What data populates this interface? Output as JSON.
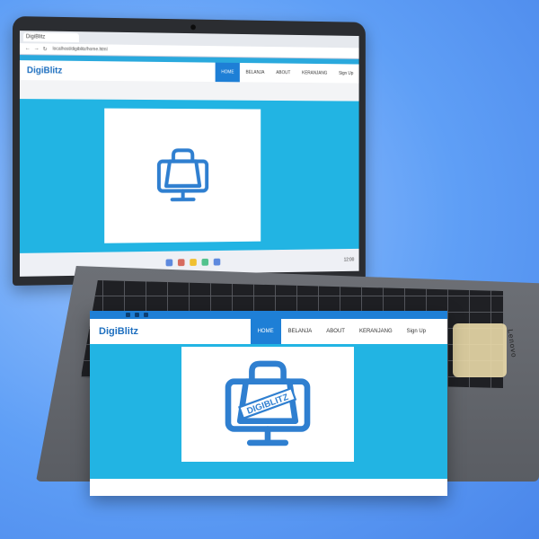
{
  "browser": {
    "tab_title": "DigiBlitz",
    "address": "localhost/digiblitz/home.html"
  },
  "site": {
    "brand": "DigiBlitz",
    "nav": [
      {
        "label": "HOME",
        "active": true
      },
      {
        "label": "BELANJA",
        "active": false
      },
      {
        "label": "ABOUT",
        "active": false
      },
      {
        "label": "KERANJANG",
        "active": false
      },
      {
        "label": "Sign Up",
        "active": false
      }
    ],
    "logo_icon": "shopping-bag-monitor-icon",
    "logo_text": "DIGIBLITZ"
  },
  "taskbar": {
    "time": "12:00"
  },
  "device": {
    "brand_label": "Lenovo"
  },
  "colors": {
    "accent": "#1e7fd6",
    "hero": "#22b4e3",
    "brand": "#1e6fbf"
  }
}
